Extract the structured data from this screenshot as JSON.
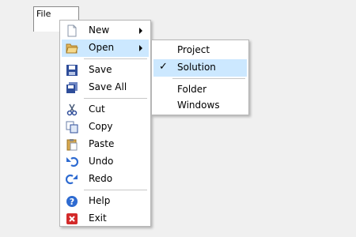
{
  "menubar": {
    "file_label": "File"
  },
  "main_menu": {
    "new": "New",
    "open": "Open",
    "save": "Save",
    "save_all": "Save All",
    "cut": "Cut",
    "copy": "Copy",
    "paste": "Paste",
    "undo": "Undo",
    "redo": "Redo",
    "help": "Help",
    "exit": "Exit"
  },
  "open_submenu": {
    "project": "Project",
    "solution": "Solution",
    "folder": "Folder",
    "windows": "Windows",
    "check_mark": "✓"
  },
  "colors": {
    "highlight": "#cce8ff",
    "border": "#b7b7b7",
    "background": "#f0f0f0"
  }
}
